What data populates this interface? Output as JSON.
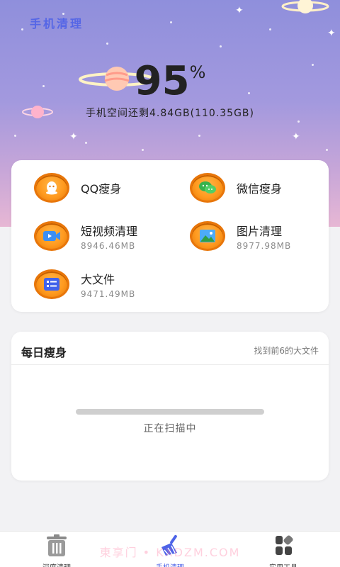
{
  "header": {
    "app_title": "手机清理",
    "percent_value": "95",
    "percent_sign": "%",
    "storage_text": "手机空间还剩4.84GB(110.35GB)"
  },
  "tools": [
    {
      "label": "QQ瘦身",
      "sub": "",
      "icon": "qq-icon"
    },
    {
      "label": "微信瘦身",
      "sub": "",
      "icon": "wechat-icon"
    },
    {
      "label": "短视频清理",
      "sub": "8946.46MB",
      "icon": "video-icon"
    },
    {
      "label": "图片清理",
      "sub": "8977.98MB",
      "icon": "image-icon"
    },
    {
      "label": "大文件",
      "sub": "9471.49MB",
      "icon": "file-list-icon"
    }
  ],
  "daily": {
    "title": "每日瘦身",
    "hint": "找到前6的大文件",
    "status": "正在扫描中",
    "progress": 0
  },
  "tabbar": {
    "items": [
      {
        "label": "深度清理",
        "icon": "trash-can-icon",
        "active": false
      },
      {
        "label": "手机清理",
        "icon": "broom-icon",
        "active": true
      },
      {
        "label": "实用工具",
        "icon": "grid-tools-icon",
        "active": false
      }
    ]
  },
  "watermark": "東享门 • KXDZM.COM",
  "colors": {
    "accent": "#4d63e8",
    "icon_orange": "#ff9a1f",
    "hero_top": "#8f8fdc",
    "hero_bottom": "#e7b7d4"
  }
}
